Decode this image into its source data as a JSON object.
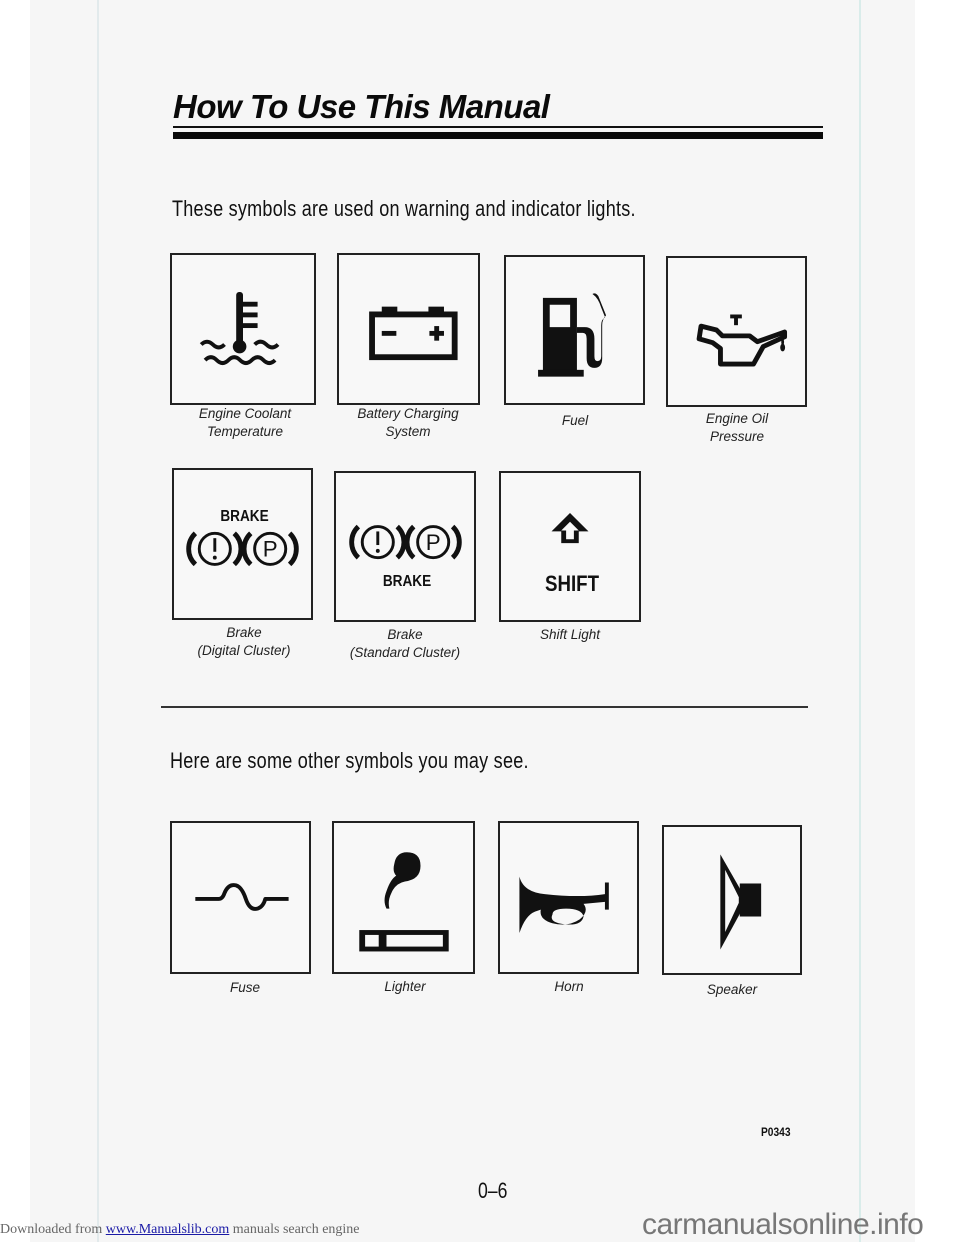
{
  "page": {
    "title": "How To Use This Manual",
    "intro_warning": "These symbols are used on warning and indicator lights.",
    "intro_other": "Here are some other symbols you may see.",
    "figure_code": "P0343",
    "page_number": "0–6"
  },
  "warning_symbols": [
    {
      "icon": "engine-coolant-temperature-icon",
      "caption_line1": "Engine Coolant",
      "caption_line2": "Temperature"
    },
    {
      "icon": "battery-icon",
      "caption_line1": "Battery Charging",
      "caption_line2": "System"
    },
    {
      "icon": "fuel-pump-icon",
      "caption_line1": "Fuel",
      "caption_line2": ""
    },
    {
      "icon": "oil-can-icon",
      "caption_line1": "Engine Oil",
      "caption_line2": "Pressure"
    },
    {
      "icon": "brake-icon",
      "label": "BRAKE",
      "caption_line1": "Brake",
      "caption_line2": "(Digital Cluster)"
    },
    {
      "icon": "brake-icon",
      "label": "BRAKE",
      "caption_line1": "Brake",
      "caption_line2": "(Standard Cluster)"
    },
    {
      "icon": "shift-arrow-icon",
      "label": "SHIFT",
      "caption_line1": "Shift Light",
      "caption_line2": ""
    }
  ],
  "other_symbols": [
    {
      "icon": "fuse-icon",
      "caption": "Fuse"
    },
    {
      "icon": "lighter-icon",
      "caption": "Lighter"
    },
    {
      "icon": "horn-icon",
      "caption": "Horn"
    },
    {
      "icon": "speaker-icon",
      "caption": "Speaker"
    }
  ],
  "footer": {
    "prefix": "Downloaded from",
    "link_text": "www.Manualslib.com",
    "suffix": "manuals search engine",
    "watermark": "carmanualsonline.info"
  }
}
